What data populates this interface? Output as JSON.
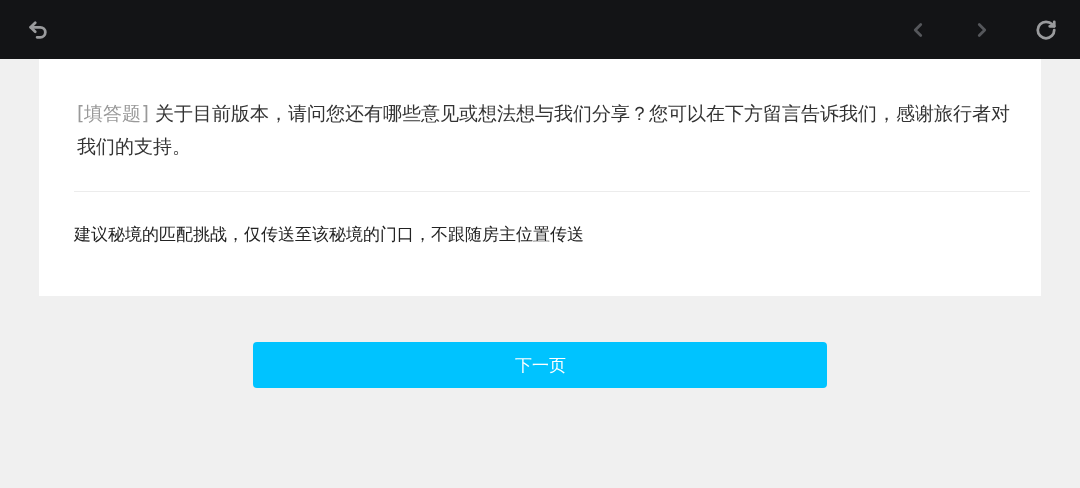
{
  "toolbar": {
    "back": {
      "disabled": false
    },
    "previous": {
      "disabled": true
    },
    "next": {
      "disabled": true
    },
    "refresh": {
      "disabled": false
    }
  },
  "question": {
    "tag": "[填答题]",
    "text": "关于目前版本，请问您还有哪些意见或想法想与我们分享？您可以在下方留言告诉我们，感谢旅行者对我们的支持。"
  },
  "answer": {
    "value": "建议秘境的匹配挑战，仅传送至该秘境的门口，不跟随房主位置传送"
  },
  "next_button": {
    "label": "下一页"
  }
}
